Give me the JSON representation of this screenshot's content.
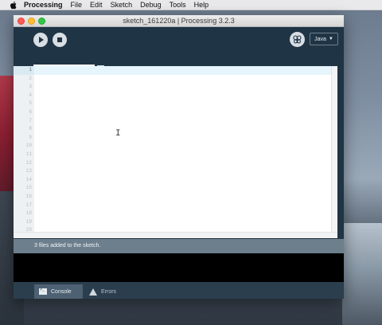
{
  "menubar": {
    "items": [
      "Processing",
      "File",
      "Edit",
      "Sketch",
      "Debug",
      "Tools",
      "Help"
    ]
  },
  "window": {
    "title": "sketch_161220a | Processing 3.2.3"
  },
  "toolbar": {
    "mode_label": "Java",
    "mode_caret": "▼"
  },
  "editor": {
    "tab_label": "sketch_161220a",
    "tab_menu_glyph": "▼",
    "line_numbers": [
      "1",
      "2",
      "3",
      "4",
      "5",
      "6",
      "7",
      "8",
      "9",
      "10",
      "11",
      "12",
      "13",
      "14",
      "15",
      "16",
      "17",
      "18",
      "19",
      "20"
    ],
    "cursor_glyph": "I"
  },
  "status": {
    "message": "3 files added to the sketch."
  },
  "footer": {
    "console_label": "Console",
    "errors_label": "Errors"
  },
  "colors": {
    "window_bg": "#1f3445",
    "status_bg": "#6d7f8d",
    "console_bg": "#000000"
  },
  "icons": {
    "menu_apple": "apple-icon",
    "run": "play-icon",
    "stop": "stop-icon",
    "debug": "debug-butterfly-icon",
    "console": "console-icon",
    "errors": "warning-icon"
  }
}
